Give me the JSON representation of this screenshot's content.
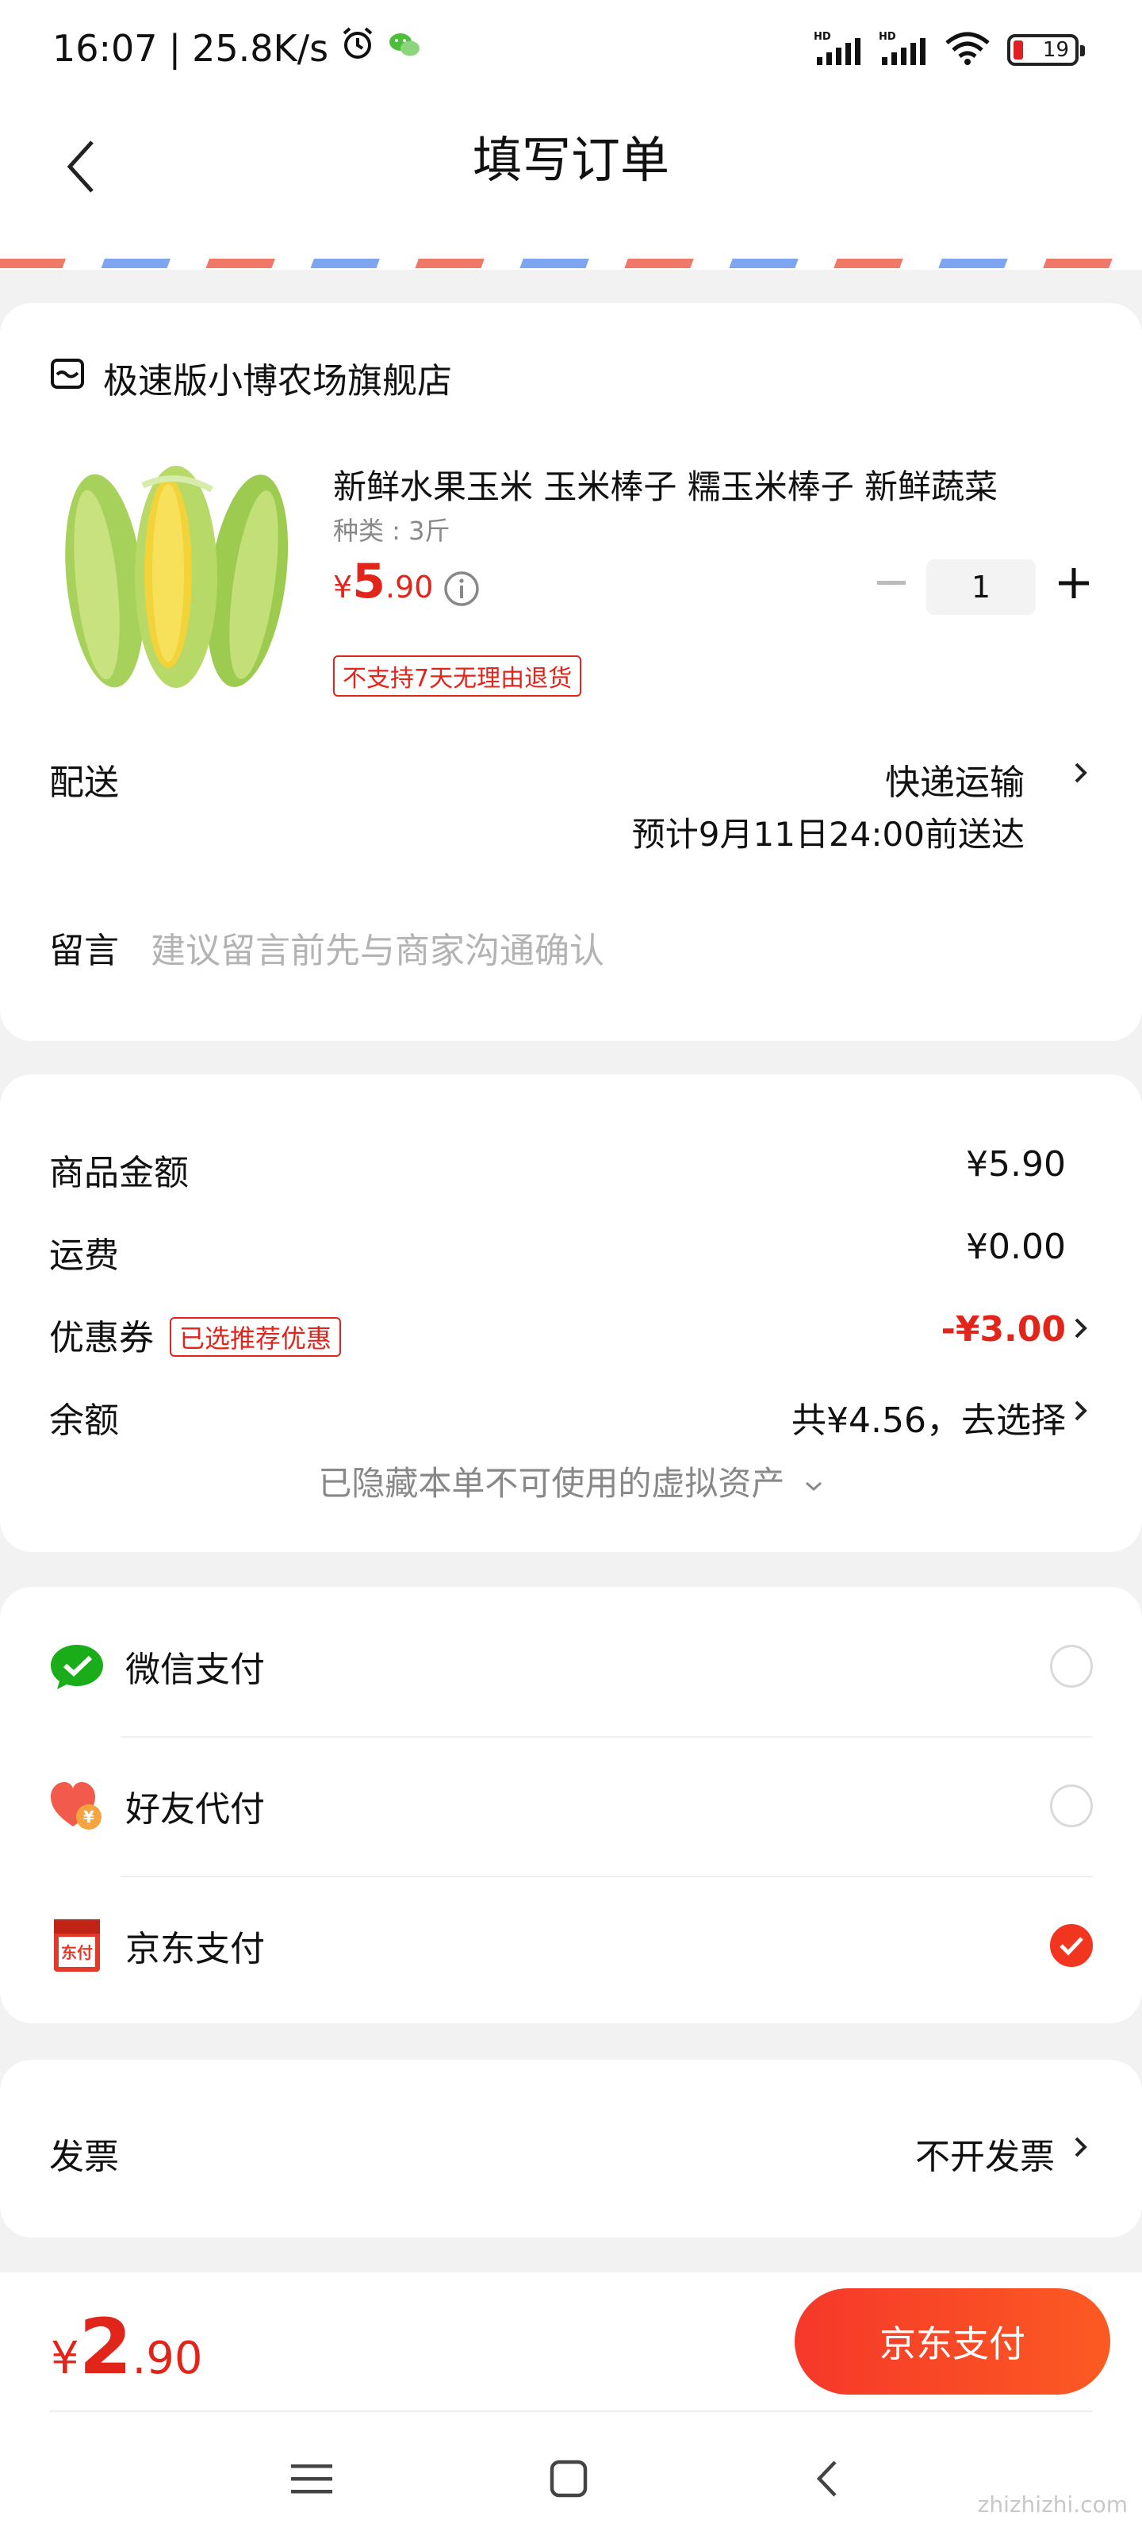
{
  "status_bar": {
    "time": "16:07",
    "speed": "25.8K/s",
    "battery": "19",
    "icons": [
      "alarm-icon",
      "wechat-icon",
      "signal-hd-icon",
      "signal-hd-icon",
      "wifi-icon",
      "battery-icon"
    ]
  },
  "nav": {
    "title": "填写订单",
    "back_icon": "chevron-left-icon"
  },
  "shop": {
    "name": "极速版小博农场旗舰店",
    "icon": "store-icon"
  },
  "product": {
    "title": "新鲜水果玉米 玉米棒子  糯玉米棒子 新鲜蔬菜",
    "spec": "种类 : 3斤",
    "price_currency": "¥",
    "price_int": "5",
    "price_dec": ".90",
    "quantity": "1",
    "return_policy": "不支持7天无理由退货"
  },
  "delivery": {
    "label": "配送",
    "method": "快递运输",
    "eta": "预计9月11日24:00前送达"
  },
  "message": {
    "label": "留言",
    "placeholder": "建议留言前先与商家沟通确认"
  },
  "summary": {
    "goods_label": "商品金额",
    "goods_value": "¥5.90",
    "shipping_label": "运费",
    "shipping_value": "¥0.00",
    "coupon_label": "优惠券",
    "coupon_tag": "已选推荐优惠",
    "coupon_value": "-¥3.00",
    "balance_label": "余额",
    "balance_value": "共¥4.56，去选择",
    "hidden_note": "已隐藏本单不可使用的虚拟资产"
  },
  "payment": {
    "options": [
      {
        "label": "微信支付",
        "icon": "wechat-pay-icon",
        "selected": false
      },
      {
        "label": "好友代付",
        "icon": "friend-pay-icon",
        "selected": false
      },
      {
        "label": "京东支付",
        "icon": "jd-pay-icon",
        "selected": true
      }
    ]
  },
  "invoice": {
    "label": "发票",
    "value": "不开发票"
  },
  "bottom": {
    "total_currency": "¥",
    "total_int": "2",
    "total_dec": ".90",
    "pay_button": "京东支付"
  },
  "watermark": "zhizhizhi.com",
  "colors": {
    "accent": "#e1251b",
    "button_gradient_start": "#f6382a",
    "button_gradient_end": "#fb5a22",
    "background": "#f2f2f2"
  }
}
